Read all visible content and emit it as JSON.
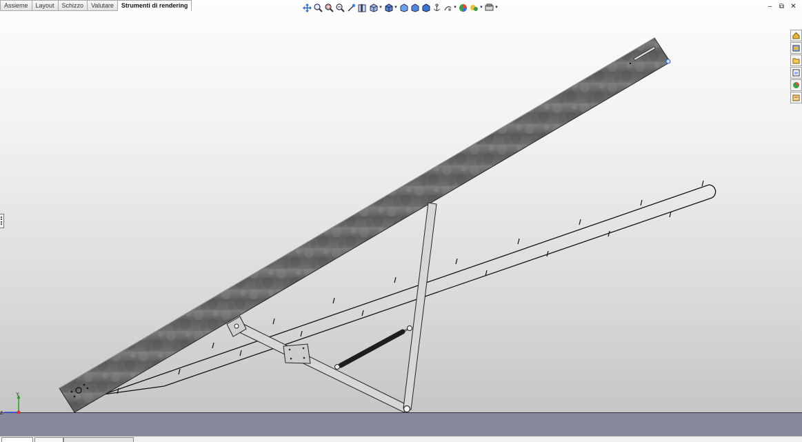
{
  "command_manager": {
    "tabs": [
      {
        "label": "Assieme"
      },
      {
        "label": "Layout"
      },
      {
        "label": "Schizzo"
      },
      {
        "label": "Valutare"
      },
      {
        "label": "Strumenti di rendering"
      }
    ],
    "active_tab": "Strumenti di rendering"
  },
  "view_toolbar": {
    "icons": [
      "move-icon",
      "zoom-to-fit-icon",
      "zoom-to-area-icon",
      "zoom-in-out-icon",
      "rotate-icon",
      "section-view-icon",
      "view-orientation-icon",
      "display-style-icon",
      "hide-show-icon",
      "edit-appearance-icon",
      "apply-scene-icon",
      "view-settings-icon",
      "render-tools-icon"
    ]
  },
  "window_controls": {
    "minimize": "–",
    "restore": "⧉",
    "close": "✕"
  },
  "triad": {
    "y_label": "Y",
    "z_label": "Z"
  },
  "colors": {
    "floor": "#86889c",
    "beam": "#6b6b6b",
    "accent": "#3a6fd8"
  }
}
